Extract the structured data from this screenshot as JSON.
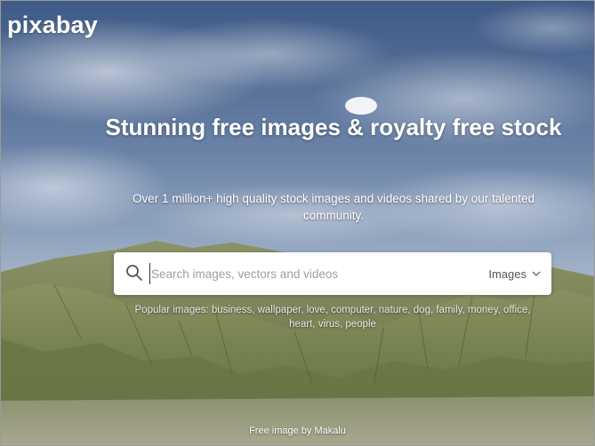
{
  "header": {
    "logo": "pixabay"
  },
  "hero": {
    "headline": "Stunning free images & royalty free stock",
    "subline": "Over 1 million+ high quality stock images and videos shared by our talented community."
  },
  "search": {
    "placeholder": "Search images, vectors and videos",
    "value": "",
    "type_selected": "Images",
    "icon": "search-icon",
    "dropdown_icon": "chevron-down-icon"
  },
  "popular": {
    "label": "Popular images:",
    "tags": [
      "business",
      "wallpaper",
      "love",
      "computer",
      "nature",
      "dog",
      "family",
      "money",
      "office",
      "heart",
      "virus",
      "people"
    ]
  },
  "credit": {
    "prefix": "Free image by",
    "author": "Makalu"
  },
  "colors": {
    "sky": "#5d7396",
    "mountain": "#7c8758",
    "text": "#ffffff",
    "search_bg": "#ffffff"
  }
}
